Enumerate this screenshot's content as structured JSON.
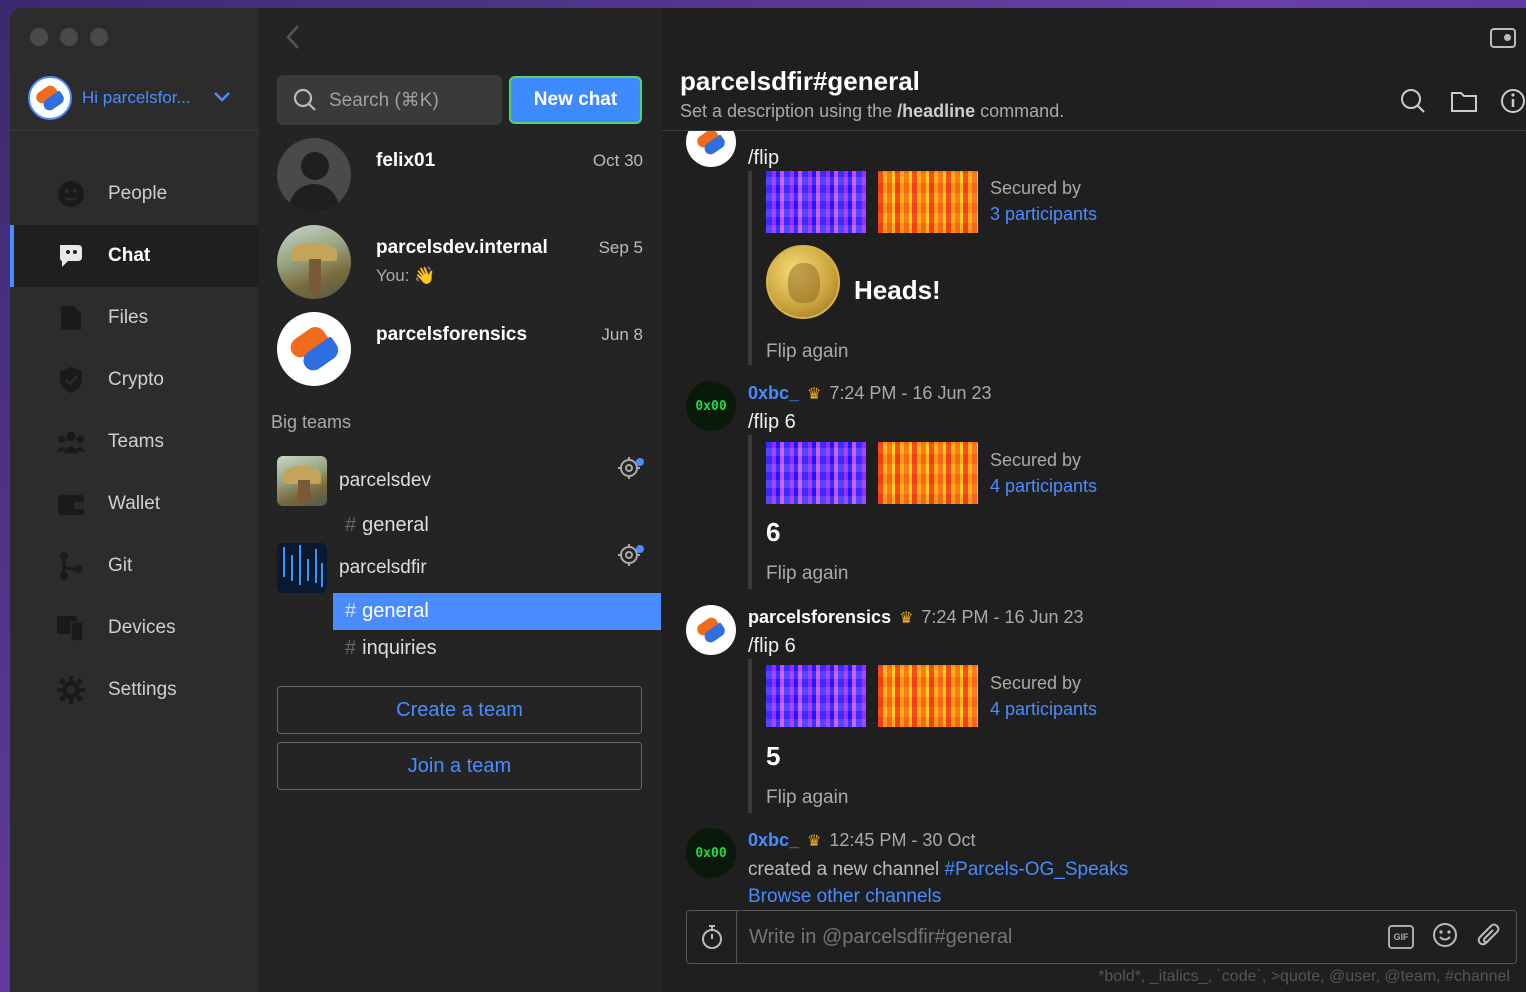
{
  "sidebar": {
    "user_label": "Hi parcelsfor...",
    "items": [
      {
        "label": "People",
        "icon": "people-icon"
      },
      {
        "label": "Chat",
        "icon": "chat-icon"
      },
      {
        "label": "Files",
        "icon": "file-icon"
      },
      {
        "label": "Crypto",
        "icon": "shield-icon"
      },
      {
        "label": "Teams",
        "icon": "teams-icon"
      },
      {
        "label": "Wallet",
        "icon": "wallet-icon"
      },
      {
        "label": "Git",
        "icon": "git-icon"
      },
      {
        "label": "Devices",
        "icon": "devices-icon"
      },
      {
        "label": "Settings",
        "icon": "gear-icon"
      }
    ],
    "active_item": "Chat"
  },
  "convlist": {
    "search_placeholder": "Search (⌘K)",
    "new_chat_label": "New chat",
    "conversations": [
      {
        "name": "felix01",
        "date": "Oct 30",
        "snippet": ""
      },
      {
        "name": "parcelsdev.internal",
        "date": "Sep 5",
        "snippet": "You: 👋"
      },
      {
        "name": "parcelsforensics",
        "date": "Jun 8",
        "snippet": ""
      }
    ],
    "big_teams_label": "Big teams",
    "teams": [
      {
        "name": "parcelsdev",
        "channels": [
          "general"
        ]
      },
      {
        "name": "parcelsdfir",
        "channels": [
          "general",
          "inquiries"
        ]
      }
    ],
    "hash": "#",
    "create_team_label": "Create a team",
    "join_team_label": "Join a team"
  },
  "header": {
    "title": "parcelsdfir#general",
    "desc_prefix": "Set a description using the ",
    "desc_cmd": "/headline",
    "desc_suffix": " command."
  },
  "messages": [
    {
      "text": "/flip",
      "secured_by": "Secured by",
      "participants": "3 participants",
      "result": "Heads!",
      "flip_again": "Flip again"
    },
    {
      "author": "0xbc_",
      "time": "7:24 PM - 16 Jun 23",
      "avatar_text": "0x00",
      "text": "/flip 6",
      "secured_by": "Secured by",
      "participants": "4 participants",
      "result": "6",
      "flip_again": "Flip again"
    },
    {
      "author": "parcelsforensics",
      "time": "7:24 PM - 16 Jun 23",
      "text": "/flip 6",
      "secured_by": "Secured by",
      "participants": "4 participants",
      "result": "5",
      "flip_again": "Flip again"
    },
    {
      "author": "0xbc_",
      "time": "12:45 PM - 30 Oct",
      "avatar_text": "0x00",
      "text_prefix": "created a new channel ",
      "channel": "#Parcels-OG_Speaks",
      "link": "Browse other channels"
    }
  ],
  "crown": "♛",
  "composer": {
    "placeholder": "Write in @parcelsdfir#general",
    "gif_label": "GIF",
    "hint": "*bold*, _italics_, `code`, >quote, @user, @team, #channel"
  },
  "colors": {
    "accent": "#4a8cff",
    "new_chat_bg": "#3d8bff",
    "crown": "#f2b21c",
    "hex_green": "#27d845"
  }
}
